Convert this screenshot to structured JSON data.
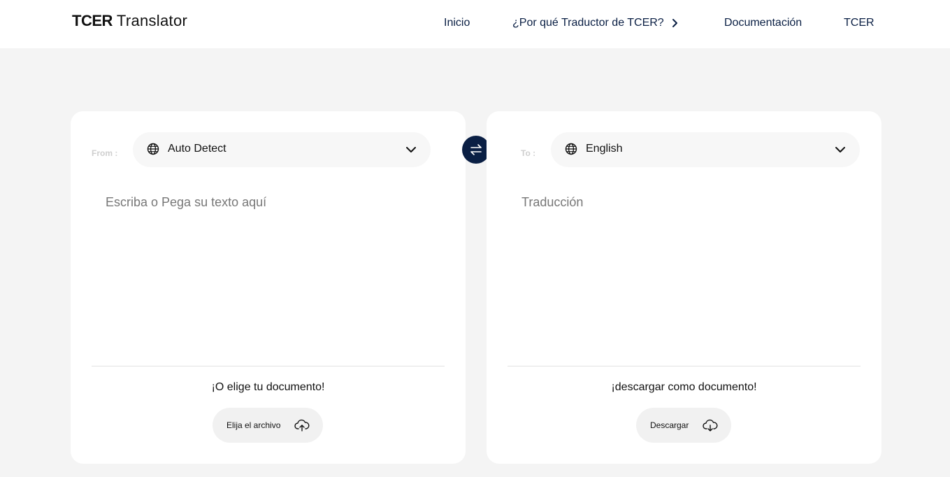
{
  "header": {
    "logo_bold": "TCER",
    "logo_light": "Translator",
    "nav": [
      {
        "label": "Inicio"
      },
      {
        "label": "¿Por qué Traductor de TCER?"
      },
      {
        "label": "Documentación"
      },
      {
        "label": "TCER"
      }
    ]
  },
  "source": {
    "direction_label": "From :",
    "language": "Auto Detect",
    "placeholder": "Escriba o Pega su texto aquí",
    "caption": "¡O elige tu documento!",
    "button_label": "Elija el archivo",
    "button_icon": "cloud-upload-icon"
  },
  "target": {
    "direction_label": "To :",
    "language": "English",
    "placeholder": "Traducción",
    "caption": "¡descargar como documento!",
    "button_label": "Descargar",
    "button_icon": "cloud-download-icon"
  },
  "swap": {
    "icon": "swap-arrows-icon"
  },
  "colors": {
    "accent": "#0a1f44",
    "background": "#f4f4f4",
    "panel": "#ffffff"
  }
}
